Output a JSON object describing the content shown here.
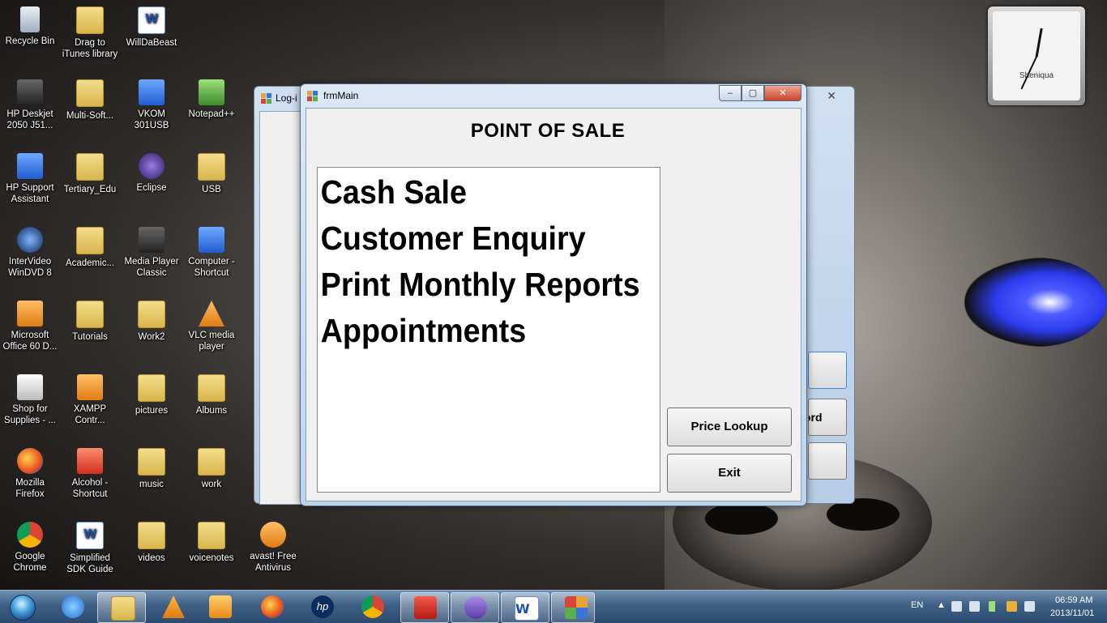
{
  "desktop_icons": [
    {
      "label": "Recycle Bin"
    },
    {
      "label": "Drag to iTunes library"
    },
    {
      "label": "WillDaBeast"
    },
    {
      "label": "HP Deskjet 2050 J51..."
    },
    {
      "label": "Multi-Soft..."
    },
    {
      "label": "VKOM 301USB"
    },
    {
      "label": "Notepad++"
    },
    {
      "label": "HP Support Assistant"
    },
    {
      "label": "Tertiary_Edu"
    },
    {
      "label": "Eclipse"
    },
    {
      "label": "USB"
    },
    {
      "label": "InterVideo WinDVD 8"
    },
    {
      "label": "Academic..."
    },
    {
      "label": "Media Player Classic"
    },
    {
      "label": "Computer - Shortcut"
    },
    {
      "label": "Microsoft Office 60 D..."
    },
    {
      "label": "Tutorials"
    },
    {
      "label": "Work2"
    },
    {
      "label": "VLC media player"
    },
    {
      "label": "Shop for Supplies - ..."
    },
    {
      "label": "XAMPP Contr..."
    },
    {
      "label": "pictures"
    },
    {
      "label": "Albums"
    },
    {
      "label": "Mozilla Firefox"
    },
    {
      "label": "Alcohol - Shortcut"
    },
    {
      "label": "music"
    },
    {
      "label": "work"
    },
    {
      "label": "Google Chrome"
    },
    {
      "label": "Simplified SDK Guide"
    },
    {
      "label": "videos"
    },
    {
      "label": "voicenotes"
    },
    {
      "label": "avast! Free Antivirus"
    }
  ],
  "clock_gadget": {
    "name": "Sheniqua"
  },
  "back_window": {
    "title": "Log-i",
    "button_fragment": "ord"
  },
  "main_window": {
    "title": "frmMain",
    "caption_minimize": "‒",
    "caption_maximize": "▢",
    "caption_close": "✕",
    "heading": "POINT OF SALE",
    "menu_items": [
      "Cash Sale",
      "Customer Enquiry",
      "Print Monthly Reports",
      "Appointments"
    ],
    "price_lookup_label": "Price Lookup",
    "exit_label": "Exit"
  },
  "taskbar": {
    "language": "EN",
    "time": "06:59 AM",
    "date": "2013/11/01",
    "hp_label": "hp",
    "word_label": "W"
  },
  "colors": {
    "accent_blue": "#2c3bf0",
    "taskbar": "#3e5f84",
    "close_red": "#c7432b"
  }
}
